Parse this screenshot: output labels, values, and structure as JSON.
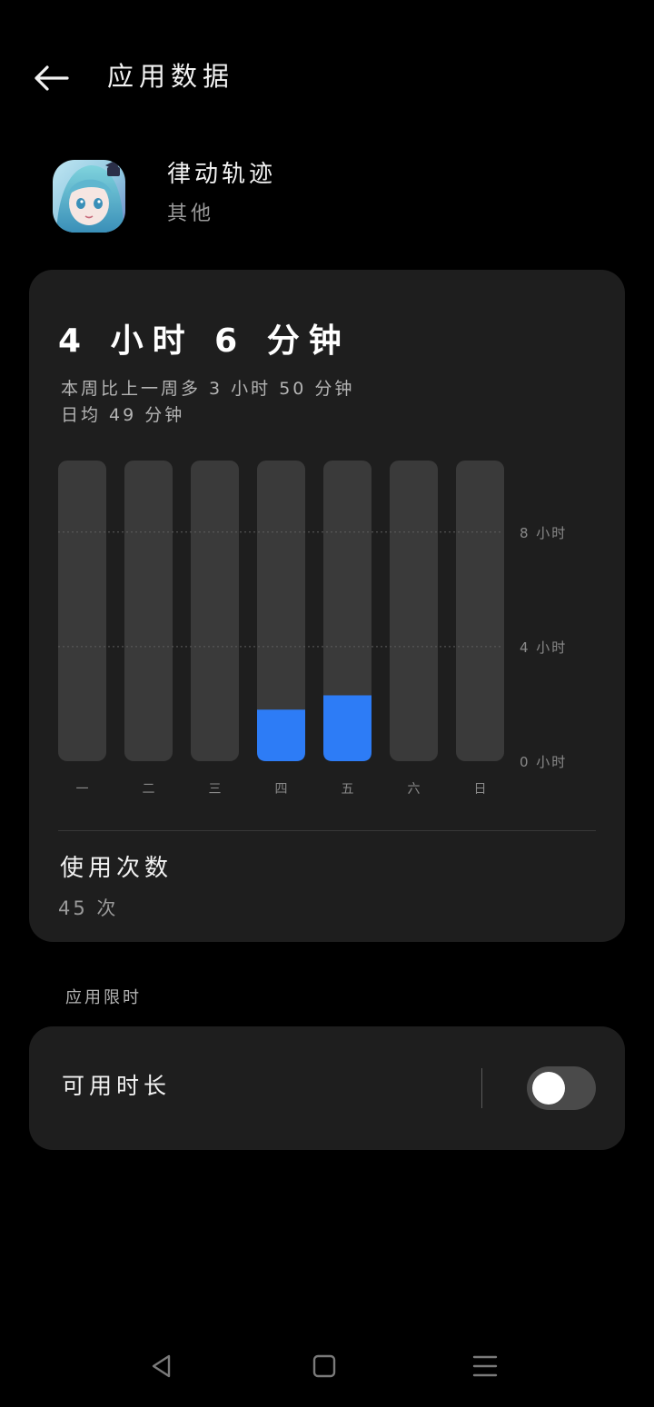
{
  "header": {
    "title": "应用数据"
  },
  "app": {
    "name": "律动轨迹",
    "category": "其他"
  },
  "usage": {
    "total": "4 小时 6 分钟",
    "comparison": "本周比上一周多 3 小时 50 分钟",
    "daily_average": "日均 49 分钟",
    "launch_label": "使用次数",
    "launch_count": "45 次"
  },
  "chart_data": {
    "type": "bar",
    "categories": [
      "一",
      "二",
      "三",
      "四",
      "五",
      "六",
      "日"
    ],
    "values": [
      0,
      0,
      0,
      1.8,
      2.3,
      0,
      0
    ],
    "ylim": [
      0,
      10.5
    ],
    "yticks": [
      0,
      4,
      8
    ],
    "ytick_labels": [
      "0 小时",
      "4 小时",
      "8 小时"
    ],
    "grid": true,
    "colors": {
      "track": "#3a3a3a",
      "bar": "#2d7cf6",
      "grid": "#5e5e5e",
      "tick_text": "#8a8a8a"
    }
  },
  "limits": {
    "section_label": "应用限时",
    "available_time_label": "可用时长",
    "enabled": false
  },
  "colors": {
    "background": "#000000",
    "card": "#1e1e1e",
    "accent": "#2d7cf6"
  }
}
